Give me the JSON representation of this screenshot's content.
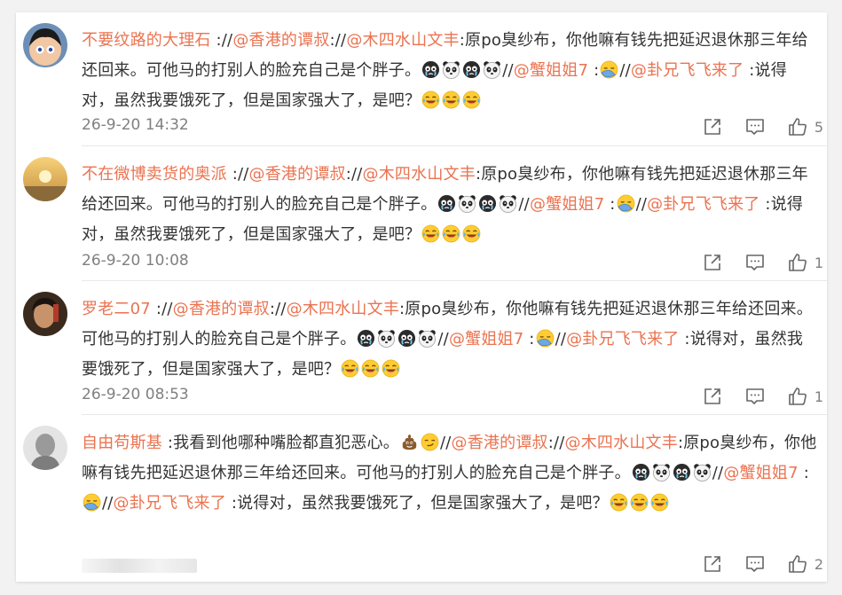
{
  "colors": {
    "accent": "#eb7350",
    "text": "#333333",
    "muted": "#808080"
  },
  "comments": [
    {
      "user": "不要纹路的大理石",
      "t1": " ://",
      "m1": "@香港的谭叔",
      "t2": "://",
      "m2": "@木四水山文丰",
      "t3": ":原po臭纱布，你他嘛有钱先把延迟退休那三年给还回来。可他马的打别人的脸充自己是个胖子。",
      "t4": "//",
      "m3": "@蟹姐姐7",
      "t5": " :",
      "t6": "//",
      "m4": "@卦兄飞飞来了",
      "t7": " :说得对，虽然我要饿死了，但是国家强大了，是吧？",
      "time": "26-9-20 14:32",
      "likes": "5"
    },
    {
      "user": "不在微博卖货的奥派",
      "t1": " ://",
      "m1": "@香港的谭叔",
      "t2": "://",
      "m2": "@木四水山文丰",
      "t3": ":原po臭纱布，你他嘛有钱先把延迟退休那三年给还回来。可他马的打别人的脸充自己是个胖子。",
      "t4": "//",
      "m3": "@蟹姐姐7",
      "t5": " :",
      "t6": "//",
      "m4": "@卦兄飞飞来了",
      "t7": " :说得对，虽然我要饿死了，但是国家强大了，是吧？",
      "time": "26-9-20 10:08",
      "likes": "1"
    },
    {
      "user": "罗老二07",
      "t1": " ://",
      "m1": "@香港的谭叔",
      "t2": "://",
      "m2": "@木四水山文丰",
      "t3": ":原po臭纱布，你他嘛有钱先把延迟退休那三年给还回来。可他马的打别人的脸充自己是个胖子。",
      "t4": "//",
      "m3": "@蟹姐姐7",
      "t5": " :",
      "t6": "//",
      "m4": "@卦兄飞飞来了",
      "t7": " :说得对，虽然我要饿死了，但是国家强大了，是吧？",
      "time": "26-9-20 08:53",
      "likes": "1"
    },
    {
      "user": "自由苟斯基",
      "t0": " :我看到他哪种嘴脸都直犯恶心。",
      "t1": "//",
      "m1": "@香港的谭叔",
      "t2": "://",
      "m2": "@木四水山文丰",
      "t3": ":原po臭纱布，你他嘛有钱先把延迟退休那三年给还回来。可他马的打别人的脸充自己是个胖子。",
      "t4": "//",
      "m3": "@蟹姐姐7",
      "t5": " :",
      "t6": "//",
      "m4": "@卦兄飞飞来了",
      "t7": " :说得对，虽然我要饿死了，但是国家强大了，是吧？",
      "likes": "2"
    }
  ]
}
